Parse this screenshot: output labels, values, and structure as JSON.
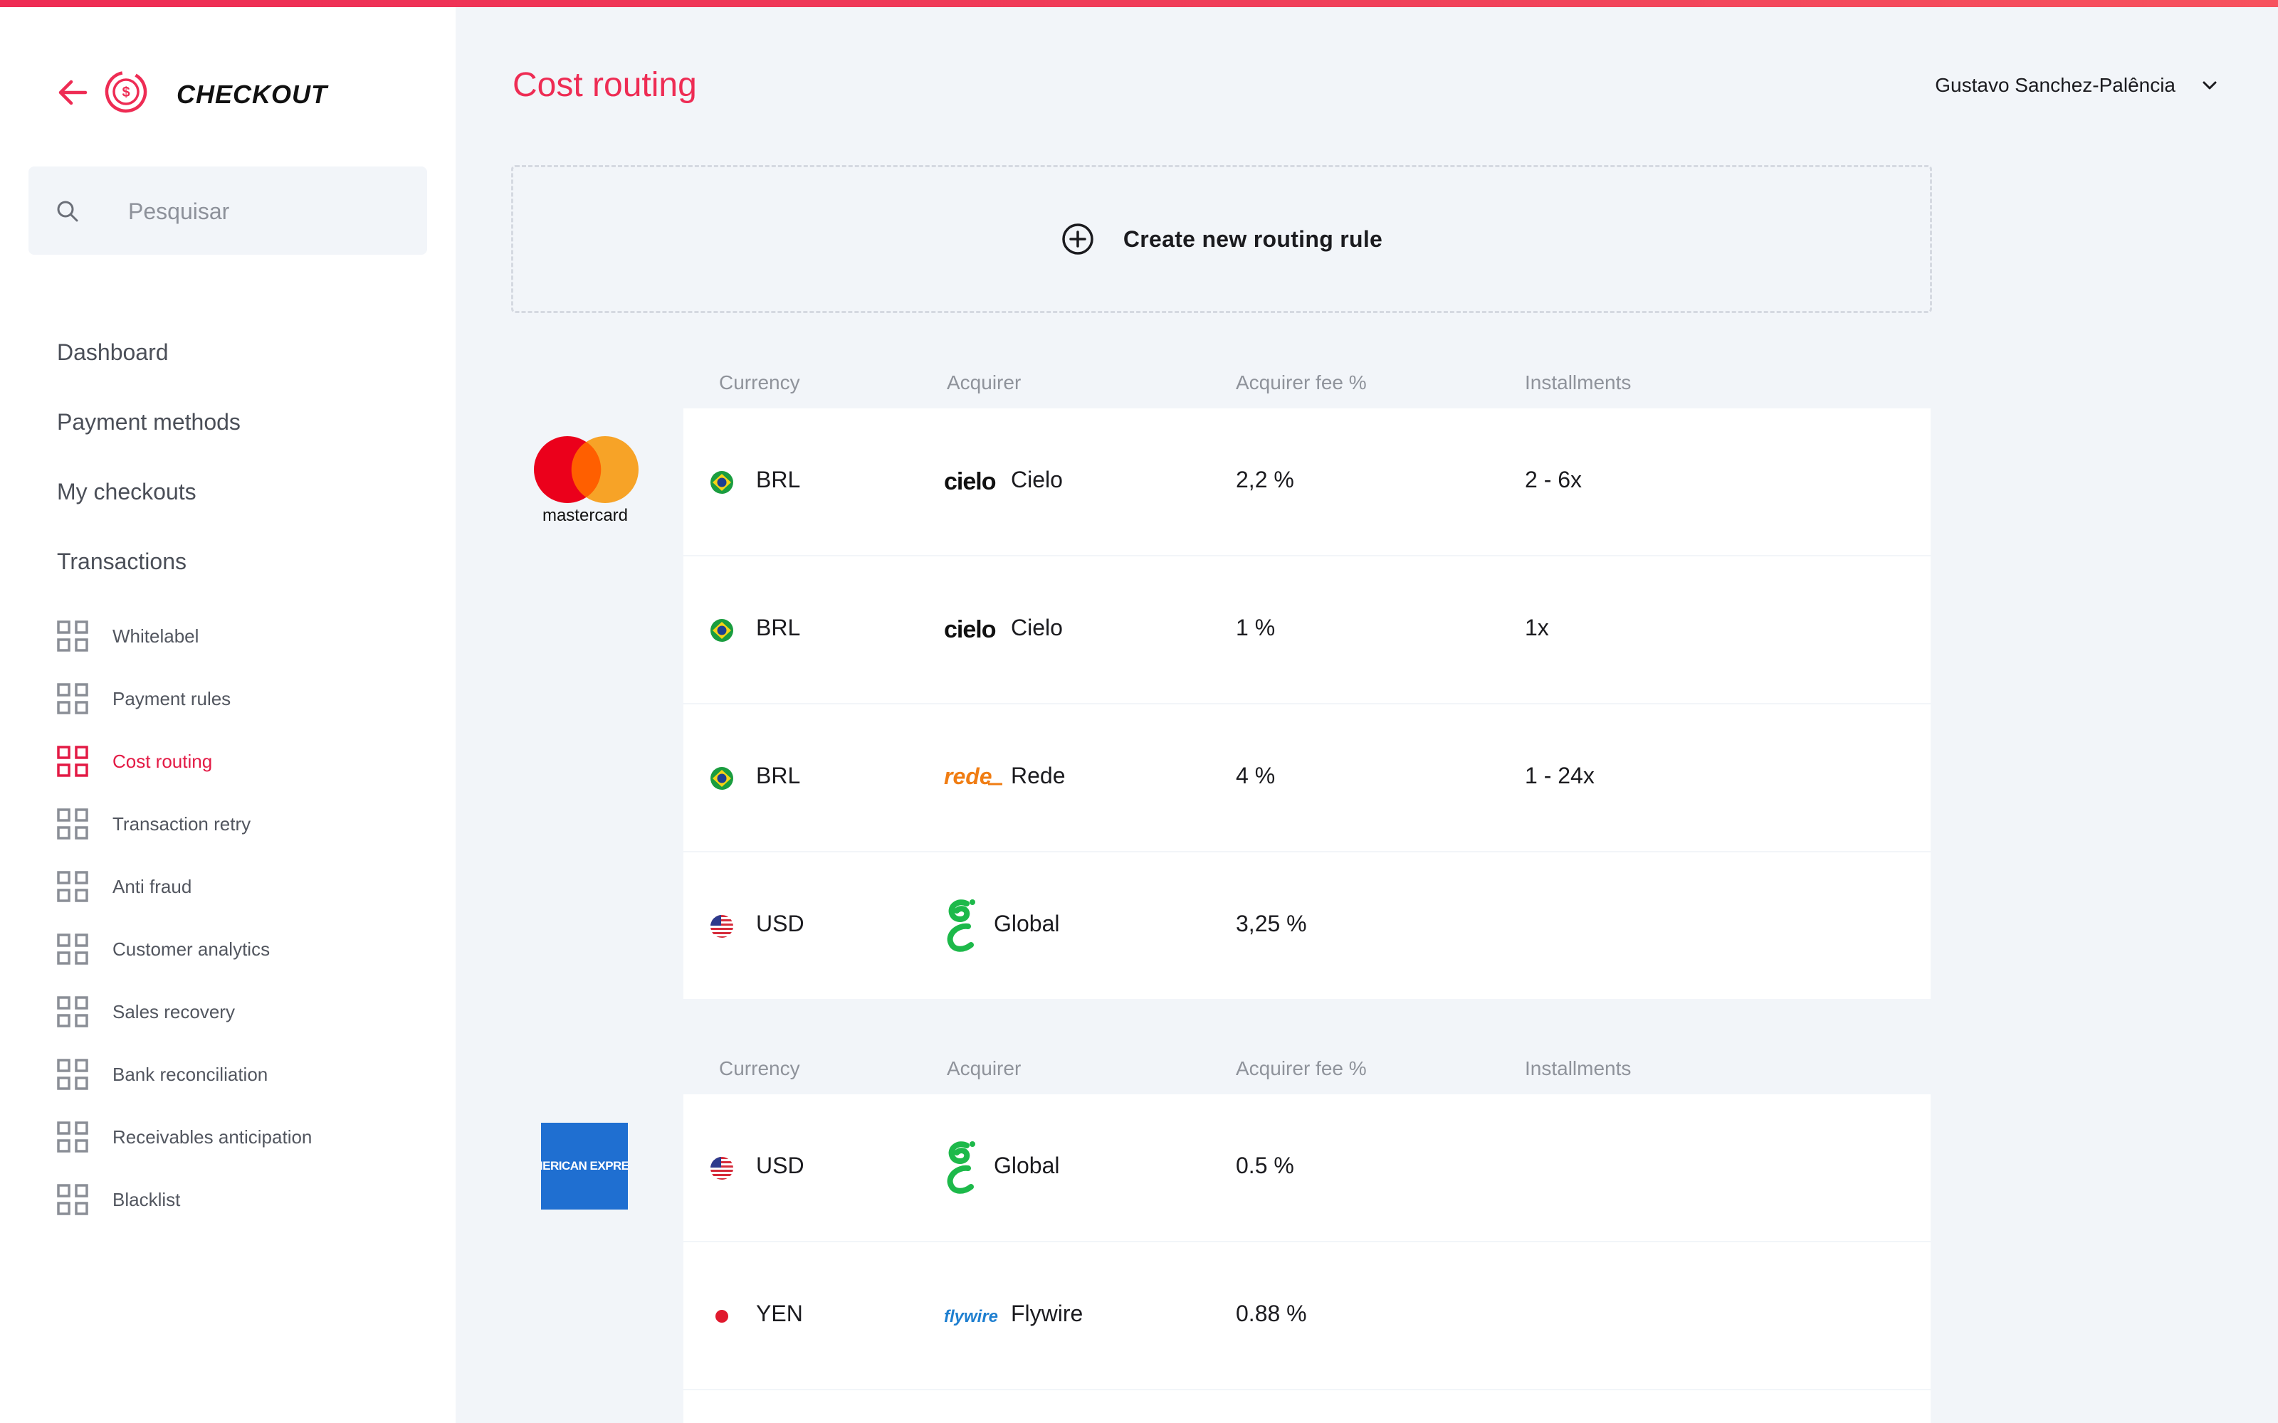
{
  "brand": {
    "name": "CHECKOUT"
  },
  "search": {
    "placeholder": "Pesquisar"
  },
  "main_nav": [
    {
      "label": "Dashboard"
    },
    {
      "label": "Payment methods"
    },
    {
      "label": "My checkouts"
    },
    {
      "label": "Transactions"
    }
  ],
  "sub_nav": [
    {
      "label": "Whitelabel",
      "active": false
    },
    {
      "label": "Payment rules",
      "active": false
    },
    {
      "label": "Cost routing",
      "active": true
    },
    {
      "label": "Transaction retry",
      "active": false
    },
    {
      "label": "Anti fraud",
      "active": false
    },
    {
      "label": "Customer analytics",
      "active": false
    },
    {
      "label": "Sales recovery",
      "active": false
    },
    {
      "label": "Bank reconciliation",
      "active": false
    },
    {
      "label": "Receivables anticipation",
      "active": false
    },
    {
      "label": "Blacklist",
      "active": false
    }
  ],
  "header": {
    "title": "Cost routing",
    "user_name": "Gustavo Sanchez-Palência"
  },
  "create": {
    "label": "Create new routing rule"
  },
  "table_headers": {
    "currency": "Currency",
    "acquirer": "Acquirer",
    "fee": "Acquirer fee %",
    "installments": "Installments"
  },
  "groups": [
    {
      "card": "mastercard",
      "card_label": "mastercard",
      "rows": [
        {
          "flag": "brazil",
          "currency": "BRL",
          "acquirer_logo": "cielo",
          "acquirer_logo_text": "cielo",
          "acquirer": "Cielo",
          "fee": "2,2 %",
          "installments": "2 - 6x"
        },
        {
          "flag": "brazil",
          "currency": "BRL",
          "acquirer_logo": "cielo",
          "acquirer_logo_text": "cielo",
          "acquirer": "Cielo",
          "fee": "1 %",
          "installments": "1x"
        },
        {
          "flag": "brazil",
          "currency": "BRL",
          "acquirer_logo": "rede",
          "acquirer_logo_text": "rede",
          "acquirer": "Rede",
          "fee": "4 %",
          "installments": "1 - 24x"
        },
        {
          "flag": "usa",
          "currency": "USD",
          "acquirer_logo": "global",
          "acquirer_logo_text": "",
          "acquirer": "Global",
          "fee": "3,25 %",
          "installments": ""
        }
      ]
    },
    {
      "card": "american-express",
      "card_label": "AMERICAN EXPRESS",
      "rows": [
        {
          "flag": "usa",
          "currency": "USD",
          "acquirer_logo": "global",
          "acquirer_logo_text": "",
          "acquirer": "Global",
          "fee": "0.5 %",
          "installments": ""
        },
        {
          "flag": "japan",
          "currency": "YEN",
          "acquirer_logo": "flywire",
          "acquirer_logo_text": "flywire",
          "acquirer": "Flywire",
          "fee": "0.88 %",
          "installments": ""
        }
      ]
    }
  ],
  "colors": {
    "accent": "#ee2c54",
    "active_nav": "#e31a45",
    "amex_blue": "#1f6fd1",
    "mastercard_red": "#eb001b",
    "mastercard_orange": "#f79e1b",
    "rede_orange": "#f07d13",
    "global_green": "#1db94a",
    "flywire_blue": "#1e7fd0"
  }
}
